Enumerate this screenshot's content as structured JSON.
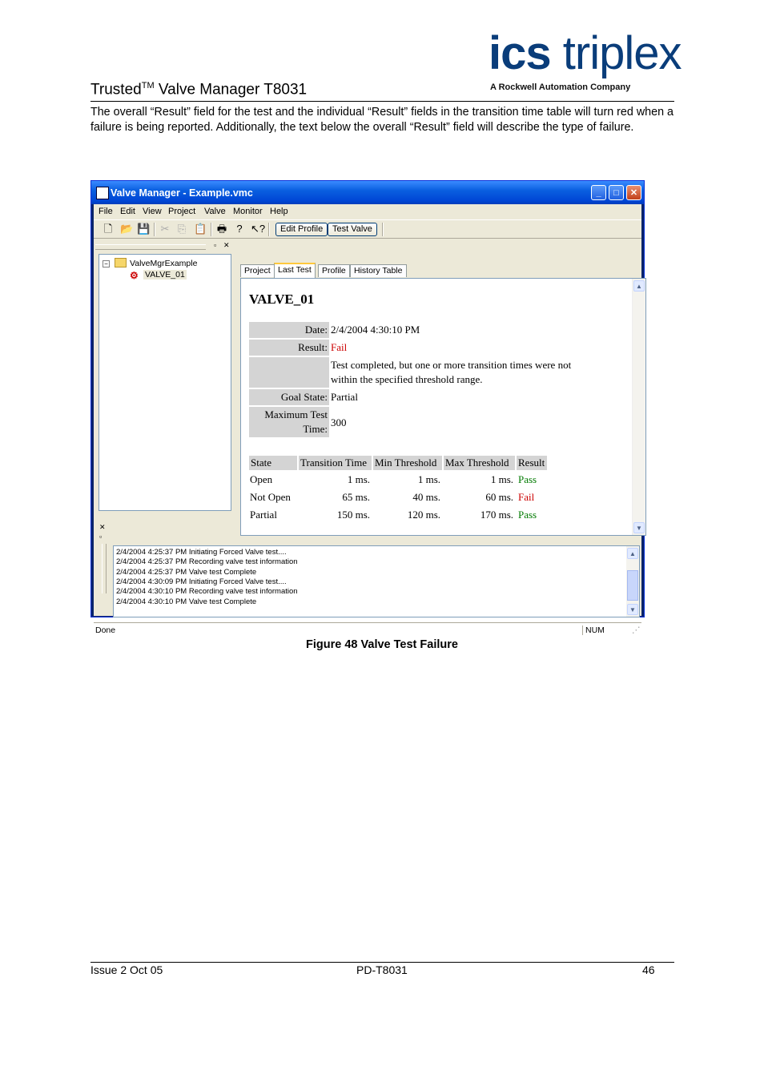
{
  "header": {
    "title_prefix": "Trusted",
    "title_tm": "TM",
    "title_suffix": " Valve Manager T8031",
    "logo_ics": "ics",
    "logo_triplex": "triplex",
    "logo_sub": "A Rockwell Automation Company"
  },
  "intro": "The overall “Result” field for the test and the individual “Result” fields in the transition time table will turn red when a failure is being reported. Additionally, the text below the overall “Result” field will describe the type of failure.",
  "window": {
    "title": "Valve Manager - Example.vmc",
    "menu": [
      "File",
      "Edit",
      "View",
      "Project",
      "Valve",
      "Monitor",
      "Help"
    ],
    "buttons": {
      "edit_profile": "Edit Profile",
      "test_valve": "Test Valve"
    },
    "tree": {
      "root": "ValveMgrExample",
      "child": "VALVE_01"
    },
    "tabs": [
      "Project",
      "Last Test",
      "Profile",
      "History Table"
    ],
    "active_tab": "Last Test"
  },
  "last_test": {
    "valve_name": "VALVE_01",
    "date_label": "Date:",
    "date_value": "2/4/2004 4:30:10 PM",
    "result_label": "Result:",
    "result_value": "Fail",
    "failure_line1": "Test completed, but one or more transition times were not",
    "failure_line2": "within the specified threshold range.",
    "goal_label": "Goal State:",
    "goal_value": "Partial",
    "max_label_line1": "Maximum Test",
    "max_label_line2": "Time:",
    "max_value": "300",
    "table_headers": [
      "State",
      "Transition Time",
      "Min Threshold",
      "Max Threshold",
      "Result"
    ],
    "rows": [
      {
        "state": "Open",
        "transition": "1 ms.",
        "min": "1 ms.",
        "max": "1 ms.",
        "result": "Pass"
      },
      {
        "state": "Not Open",
        "transition": "65 ms.",
        "min": "40 ms.",
        "max": "60 ms.",
        "result": "Fail"
      },
      {
        "state": "Partial",
        "transition": "150 ms.",
        "min": "120 ms.",
        "max": "170 ms.",
        "result": "Pass"
      }
    ]
  },
  "log": [
    "2/4/2004 4:25:37 PM Initiating Forced Valve test....",
    "2/4/2004 4:25:37 PM Recording valve test information",
    "2/4/2004 4:25:37 PM Valve test Complete",
    "2/4/2004 4:30:09 PM Initiating Forced Valve test....",
    "2/4/2004 4:30:10 PM Recording valve test information",
    "2/4/2004 4:30:10 PM Valve test Complete"
  ],
  "status": {
    "left": "Done",
    "num": "NUM"
  },
  "caption": "Figure 48 Valve Test Failure",
  "footer": {
    "left": "Issue 2 Oct 05",
    "center": "PD-T8031",
    "right": "46"
  }
}
